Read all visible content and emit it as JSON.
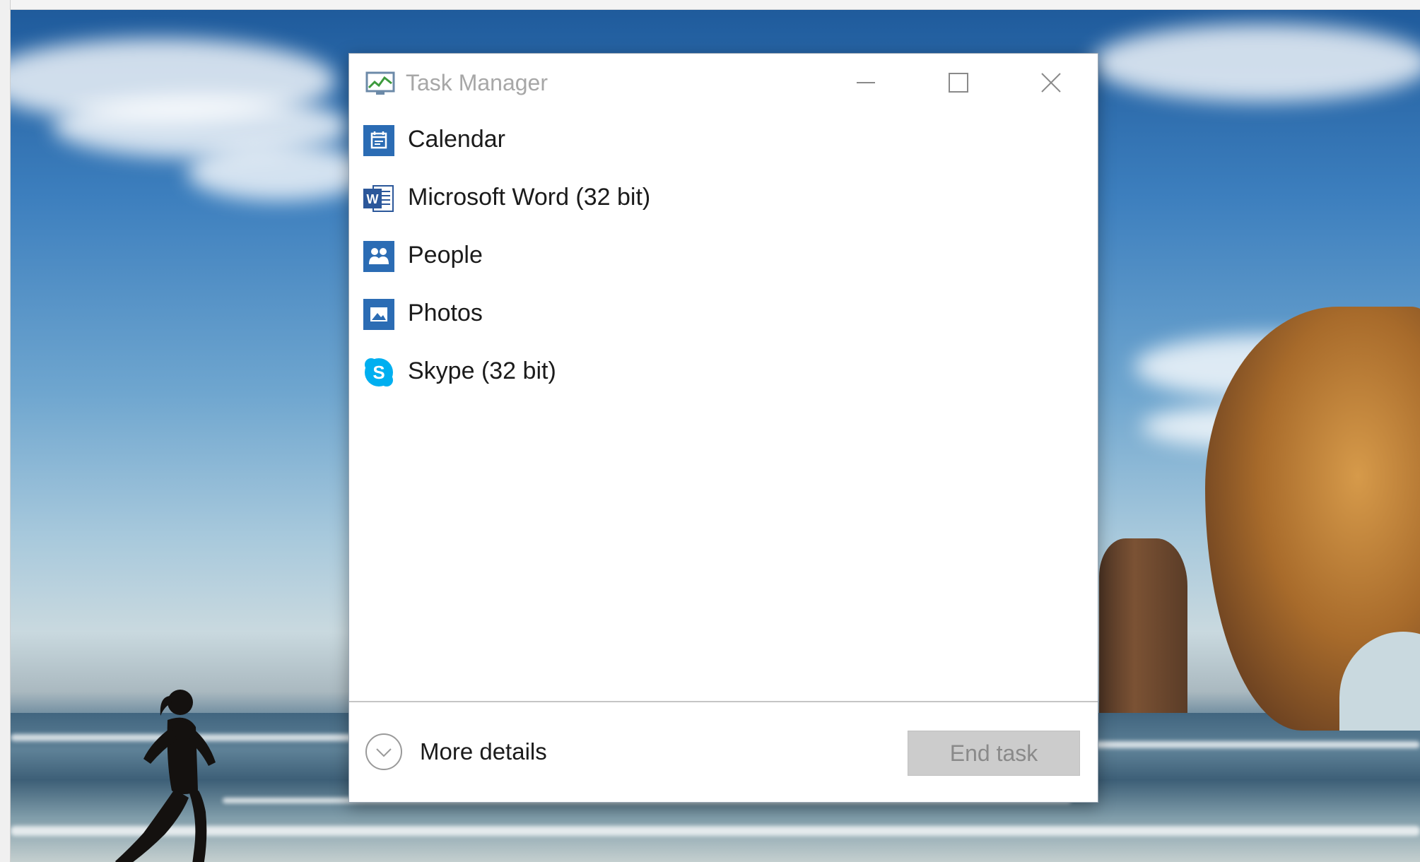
{
  "window": {
    "title": "Task Manager",
    "controls": {
      "minimize_icon": "minimize-icon",
      "maximize_icon": "maximize-icon",
      "close_icon": "close-icon"
    }
  },
  "apps": [
    {
      "label": "Calendar",
      "icon": "calendar-icon",
      "color": "#2b6cb4"
    },
    {
      "label": "Microsoft Word (32 bit)",
      "icon": "word-icon",
      "color": "#2b579a"
    },
    {
      "label": "People",
      "icon": "people-icon",
      "color": "#2b6cb4"
    },
    {
      "label": "Photos",
      "icon": "photos-icon",
      "color": "#2b6cb4"
    },
    {
      "label": "Skype (32 bit)",
      "icon": "skype-icon",
      "color": "#00aff0"
    }
  ],
  "footer": {
    "more_details_label": "More details",
    "end_task_label": "End task",
    "end_task_enabled": false
  },
  "colors": {
    "accent": "#2b6cb4",
    "title_text": "#a7a7a7",
    "disabled_button": "#cccccc"
  }
}
